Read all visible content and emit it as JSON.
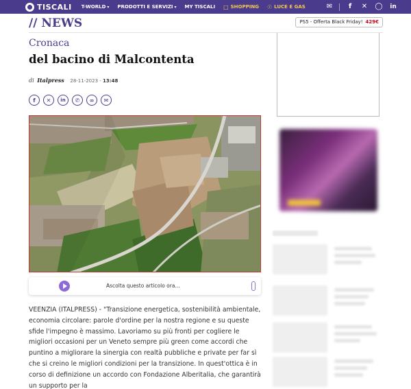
{
  "brand": {
    "name": "TISCALI"
  },
  "nav": {
    "items": [
      {
        "label": "T-WORLD",
        "caret": "▾"
      },
      {
        "label": "PRODOTTI E SERVIZI",
        "caret": "▾"
      },
      {
        "label": "MY TISCALI",
        "caret": ""
      },
      {
        "label": "SHOPPING",
        "icon": "shopping-bag-icon"
      },
      {
        "label": "LUCE E GAS",
        "icon": "bulb-icon"
      }
    ],
    "accent_color": "#f2c94c"
  },
  "top_icons": [
    "mail-icon",
    "facebook-icon",
    "x-icon",
    "instagram-icon",
    "linkedin-icon"
  ],
  "section": {
    "title": "// NEWS"
  },
  "promo": {
    "text": "PS5 - Offerta Black Friday!",
    "price": "429€"
  },
  "article": {
    "category": "Cronaca",
    "headline": "del bacino di Malcontenta",
    "byline_prefix": "di",
    "author": "Italpress",
    "date": "28-11-2023",
    "time_sep": " - ",
    "time": "13:48",
    "share": [
      "facebook",
      "x",
      "linkedin",
      "whatsapp",
      "link",
      "email"
    ],
    "audio_label": "Ascolta questo articolo ora...",
    "body": "VEENZIA (ITALPRESS) - \"Transizione energetica, sostenibilità ambientale, economia circolare: parole d'ordine per la nostra regione e su queste sfide l'impegno è massimo. Lavoriamo su più fronti per cogliere le migliori occasioni per un Veneto sempre più green come accordi che puntino a migliorare la sinergia con realtà pubbliche e private per far sì che si creino le migliori condizioni per la transizione. In quest'ottica è in corso di definizione un accordo con Fondazione Alberitalia, che garantirà un supporto per la"
  },
  "colors": {
    "brand": "#4a3b8c",
    "promo_price": "#d0021b",
    "audio_accent": "#8e6ad8"
  }
}
